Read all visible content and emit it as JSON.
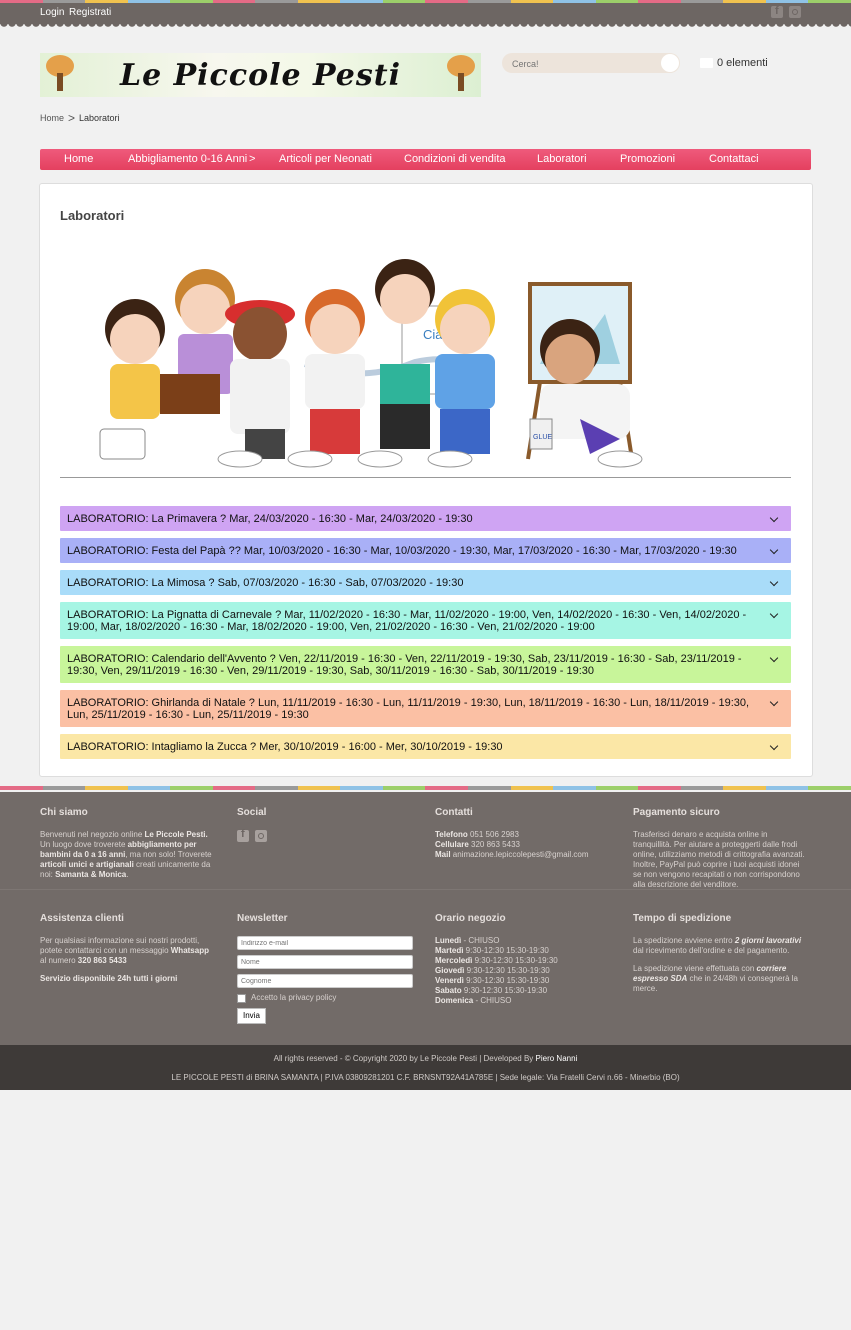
{
  "topbar": {
    "login": "Login",
    "register": "Registrati",
    "stripe_colors": [
      "#e46b86",
      "#9a9a9a",
      "#f0c24f",
      "#8fc2e6",
      "#9ccf6a",
      "#e46b86",
      "#9a9a9a",
      "#f0c24f",
      "#8fc2e6",
      "#9ccf6a",
      "#e46b86",
      "#9a9a9a",
      "#f0c24f",
      "#8fc2e6",
      "#9ccf6a",
      "#e46b86",
      "#9a9a9a",
      "#f0c24f",
      "#8fc2e6",
      "#9ccf6a"
    ],
    "icons": [
      "facebook-icon",
      "instagram-icon"
    ]
  },
  "header": {
    "logo_text": "Le Piccole Pesti",
    "search_placeholder": "Cerca!",
    "cart_label": "0 elementi"
  },
  "breadcrumb": {
    "home": "Home",
    "separator": ">",
    "current": "Laboratori"
  },
  "nav": {
    "items": [
      "Home",
      "Abbigliamento 0-16 Anni",
      ">",
      "Articoli per Neonati",
      "Condizioni di vendita",
      "Laboratori",
      "Promozioni",
      "Contattaci"
    ],
    "color": "#e84a6c"
  },
  "main": {
    "title": "Laboratori",
    "hero_speech": "Ciao",
    "hero_label": "GLUE",
    "accordion": [
      {
        "text": "LABORATORIO: La Primavera ? Mar, 24/03/2020 - 16:30 - Mar, 24/03/2020 - 19:30",
        "color": "#cfa4f3"
      },
      {
        "text": "LABORATORIO: Festa del Papà ?? Mar, 10/03/2020 - 16:30 - Mar, 10/03/2020 - 19:30, Mar, 17/03/2020 - 16:30 - Mar, 17/03/2020 - 19:30",
        "color": "#a9b0f7"
      },
      {
        "text": "LABORATORIO: La Mimosa ? Sab, 07/03/2020 - 16:30 - Sab, 07/03/2020 - 19:30",
        "color": "#a9dcf9"
      },
      {
        "text": "LABORATORIO: La Pignatta di Carnevale ? Mar, 11/02/2020 - 16:30 - Mar, 11/02/2020 - 19:00, Ven, 14/02/2020 - 16:30 - Ven, 14/02/2020 - 19:00, Mar, 18/02/2020 - 16:30 - Mar, 18/02/2020 - 19:00, Ven, 21/02/2020 - 16:30 - Ven, 21/02/2020 - 19:00",
        "color": "#a6f5e4"
      },
      {
        "text": "LABORATORIO: Calendario dell'Avvento ? Ven, 22/11/2019 - 16:30 - Ven, 22/11/2019 - 19:30, Sab, 23/11/2019 - 16:30 - Sab, 23/11/2019 - 19:30, Ven, 29/11/2019 - 16:30 - Ven, 29/11/2019 - 19:30, Sab, 30/11/2019 - 16:30 - Sab, 30/11/2019 - 19:30",
        "color": "#c8f59a"
      },
      {
        "text": "LABORATORIO: Ghirlanda di Natale ? Lun, 11/11/2019 - 16:30 - Lun, 11/11/2019 - 19:30, Lun, 18/11/2019 - 16:30 - Lun, 18/11/2019 - 19:30, Lun, 25/11/2019 - 16:30 - Lun, 25/11/2019 - 19:30",
        "color": "#fbc0a4"
      },
      {
        "text": "LABORATORIO: Intagliamo la Zucca ? Mer, 30/10/2019 - 16:00 - Mer, 30/10/2019 - 19:30",
        "color": "#fbe7a6"
      }
    ]
  },
  "footer": {
    "chi_siamo": {
      "title": "Chi siamo",
      "t1": "Benvenuti nel negozio online ",
      "b1": "Le Piccole Pesti.",
      "t2": " Un luogo dove troverete ",
      "b2": "abbigliamento per bambini da 0 a 16 anni",
      "t3": ", ma non  solo! Troverete ",
      "b3": "articoli unici e artigianali",
      "t4": " creati unicamente da noi: ",
      "b4": "Samanta & Monica",
      "t5": "."
    },
    "social": {
      "title": "Social"
    },
    "contatti": {
      "title": "Contatti",
      "tel_label": "Telefono",
      "tel": "051 506 2983",
      "cell_label": "Cellulare",
      "cell": "320 863 5433",
      "mail_label": "Mail",
      "mail": "animazione.lepiccolepesti@gmail.com"
    },
    "pagamento": {
      "title": "Pagamento sicuro",
      "text": "Trasferisci denaro e acquista online in tranquillità. Per aiutare a proteggerti dalle frodi online, utilizziamo metodi di crittografia avanzati. Inoltre, PayPal può coprire i tuoi acquisti idonei se non vengono recapitati o non corrispondono alla descrizione del venditore."
    },
    "assistenza": {
      "title": "Assistenza clienti",
      "text": "Per qualsiasi informazione sui nostri prodotti, potete contattarci con un messaggio ",
      "whatsapp": "Whatsapp",
      "text2": " al numero ",
      "number": "320 863 5433",
      "service": "Servizio disponibile 24h tutti i giorni"
    },
    "newsletter": {
      "title": "Newsletter",
      "email_placeholder": "Indirizzo e-mail",
      "name_placeholder": "Nome",
      "surname_placeholder": "Cognome",
      "privacy": "Accetto la privacy policy",
      "submit": "Invia"
    },
    "orario": {
      "title": "Orario negozio",
      "days": [
        {
          "day": "Lunedì",
          "hours": " - CHIUSO"
        },
        {
          "day": "Martedì",
          "hours": " 9:30-12:30 15:30-19:30"
        },
        {
          "day": "Mercoledì",
          "hours": " 9:30-12:30 15:30-19:30"
        },
        {
          "day": "Giovedì",
          "hours": " 9:30-12:30 15:30-19:30"
        },
        {
          "day": "Venerdì",
          "hours": " 9:30-12:30 15:30-19:30"
        },
        {
          "day": "Sabato",
          "hours": " 9:30-12:30 15:30-19:30"
        },
        {
          "day": "Domenica",
          "hours": " - CHIUSO"
        }
      ]
    },
    "spedizione": {
      "title": "Tempo di spedizione",
      "t1": "La spedizione avviene entro ",
      "b1": "2 giorni lavorativi",
      "t2": " dal ricevimento dell'ordine e del pagamento.",
      "t3": "La spedizione viene effettuata con ",
      "b2": "corriere espresso SDA",
      "t4": " che in 24/48h vi consegnerà la merce."
    },
    "copyright": "All rights reserved - © Copyright 2020 by Le Piccole Pesti | Developed By ",
    "developer": "Piero Nanni",
    "legal": "LE PICCOLE PESTI di BRINA SAMANTA | P.IVA 03809281201  C.F. BRNSNT92A41A785E | Sede legale: Via Fratelli Cervi n.66 - Minerbio (BO)"
  }
}
